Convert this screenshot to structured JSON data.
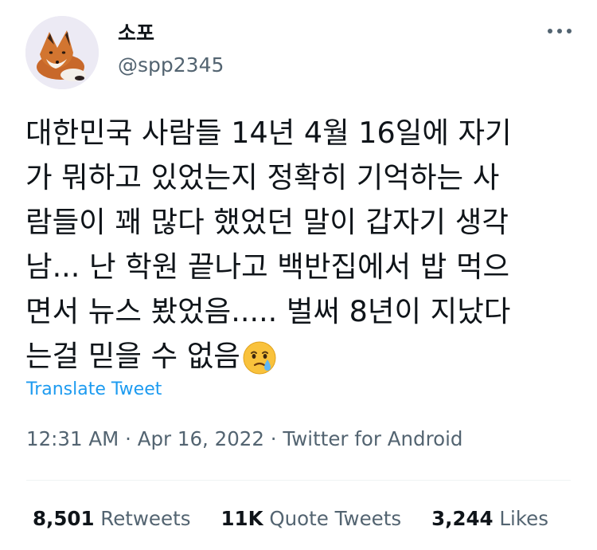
{
  "author": {
    "display_name": "소포",
    "handle": "@spp2345",
    "avatar_icon": "fox-avatar"
  },
  "tweet": {
    "text_lines": [
      "대한민국 사람들 14년 4월 16일에 자기",
      "가 뭐하고 있었는지 정확히 기억하는 사",
      "람들이 꽤 많다 했었던 말이 갑자기 생각",
      "남... 난 학원 끝나고 백반집에서 밥 먹으",
      "면서 뉴스 봤었음..... 벌써 8년이 지났다",
      "는걸 믿을 수 없음"
    ],
    "emoji": "face-holding-back-tears"
  },
  "translate_label": "Translate Tweet",
  "meta": {
    "time": "12:31 AM",
    "date": "Apr 16, 2022",
    "source": "Twitter for Android",
    "separator": "·"
  },
  "stats": {
    "retweets": {
      "count": "8,501",
      "label": "Retweets"
    },
    "quote_tweets": {
      "count": "11K",
      "label": "Quote Tweets"
    },
    "likes": {
      "count": "3,244",
      "label": "Likes"
    }
  },
  "colors": {
    "link": "#1d9bf0",
    "secondary_text": "#536471",
    "primary_text": "#0f1419",
    "divider": "#eff3f4"
  }
}
